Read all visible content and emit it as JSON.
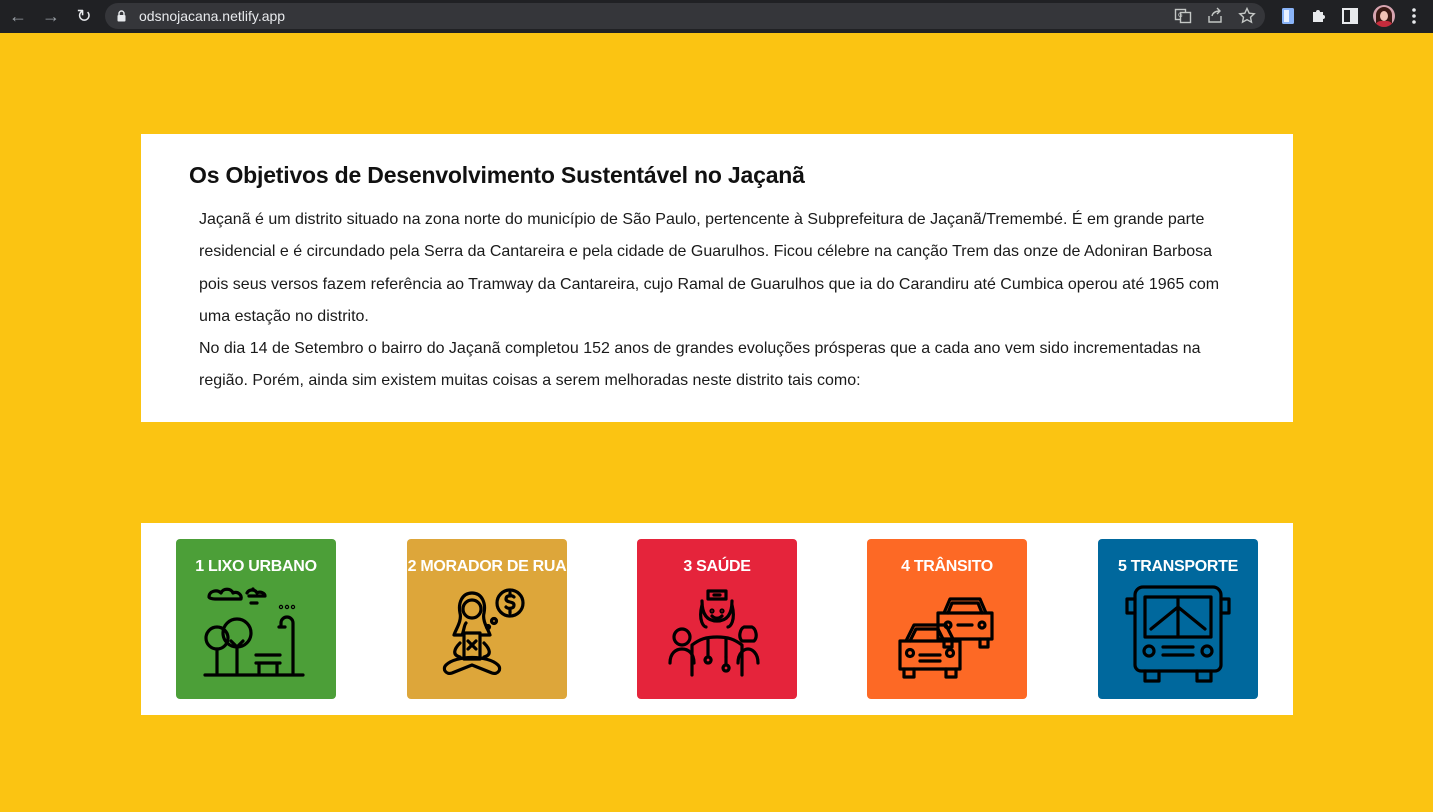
{
  "browser": {
    "url": "odsnojacana.netlify.app",
    "nav_icons": [
      "back-arrow-icon",
      "forward-arrow-icon",
      "reload-icon"
    ],
    "toolbar_icons": [
      "translate-icon",
      "share-icon",
      "star-icon",
      "extension-doc-icon",
      "puzzle-icon",
      "sidepanel-icon",
      "profile-avatar",
      "menu-kebab-icon"
    ]
  },
  "intro": {
    "title": "Os Objetivos de Desenvolvimento Sustentável no Jaçanã",
    "paragraph_1": "Jaçanã é um distrito situado na zona norte do município de São Paulo, pertencente à Subprefeitura de Jaçanã/Tremembé. É em grande parte residencial e é circundado pela Serra da Cantareira e pela cidade de Guarulhos. Ficou célebre na canção Trem das onze de Adoniran Barbosa pois seus versos fazem referência ao Tramway da Cantareira, cujo Ramal de Guarulhos que ia do Carandiru até Cumbica operou até 1965 com uma estação no distrito.",
    "paragraph_2": "No dia 14 de Setembro o bairro do Jaçanã completou 152 anos de grandes evoluções prósperas que a cada ano vem sido incrementadas na região. Porém, ainda sim existem muitas coisas a serem melhoradas neste distrito tais como:"
  },
  "ods": [
    {
      "label": "1 LIXO URBANO",
      "color": "#4c9f38",
      "icon": "urban-park-icon"
    },
    {
      "label": "2 MORADOR DE RUA",
      "color": "#dda63a",
      "icon": "homeless-person-icon"
    },
    {
      "label": "3 SAÚDE",
      "color": "#e5243b",
      "icon": "health-workers-icon"
    },
    {
      "label": "4 TRÂNSITO",
      "color": "#fd6925",
      "icon": "traffic-cars-icon"
    },
    {
      "label": "5 TRANSPORTE",
      "color": "#00689d",
      "icon": "bus-icon"
    }
  ],
  "colors": {
    "page_background": "#fbc412",
    "card_background": "#ffffff"
  }
}
